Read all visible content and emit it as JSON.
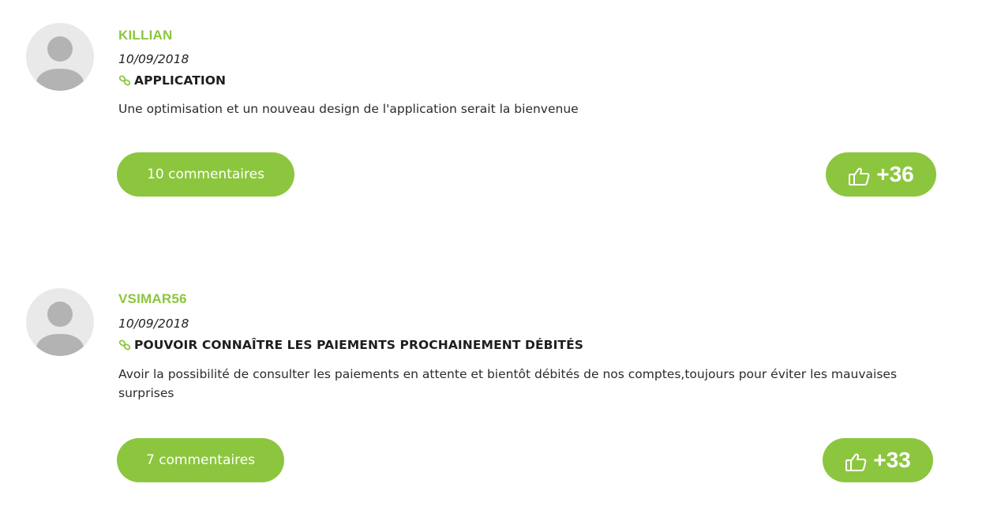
{
  "colors": {
    "accent": "#8cc63f",
    "avatar_bg": "#e9e9e9",
    "avatar_fg": "#b3b3b3"
  },
  "posts": [
    {
      "author": "KILLIAN",
      "date": "10/09/2018",
      "title": "APPLICATION",
      "body": "Une optimisation et un nouveau design de l'application serait la bienvenue",
      "comments_label": "10 commentaires",
      "votes": "+36"
    },
    {
      "author": "VSIMAR56",
      "date": "10/09/2018",
      "title": "POUVOIR CONNAÎTRE LES PAIEMENTS PROCHAINEMENT DÉBITÉS",
      "body": "Avoir la possibilité de consulter les paiements en attente et bientôt débités de nos comptes,toujours pour éviter les mauvaises surprises",
      "comments_label": "7 commentaires",
      "votes": "+33"
    }
  ]
}
